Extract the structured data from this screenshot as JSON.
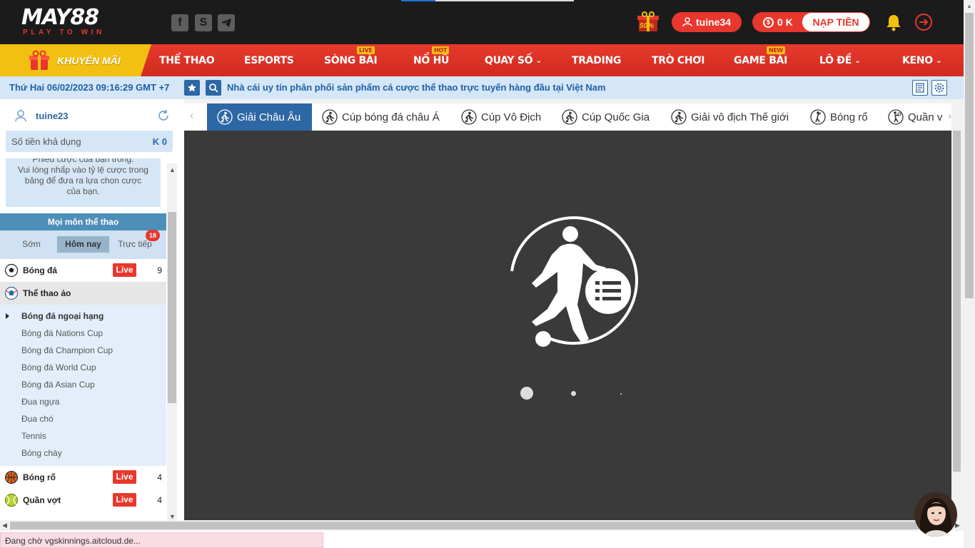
{
  "header": {
    "logo_text": "MAY88",
    "logo_tagline": "PLAY TO WIN",
    "promo_badge": "50%",
    "username": "tuine34",
    "balance": "0 K",
    "balance_currency": "$",
    "deposit_label": "NẠP TIỀN",
    "icons": [
      "facebook-icon",
      "skype-icon",
      "telegram-icon",
      "bell-icon",
      "logout-icon"
    ]
  },
  "nav": {
    "promo_label": "KHUYẾN MÃI",
    "items": [
      {
        "label": "THỂ THAO"
      },
      {
        "label": "ESPORTS"
      },
      {
        "label": "SÒNG BÀI",
        "badge": "LIVE"
      },
      {
        "label": "NỔ HŨ",
        "badge": "HOT"
      },
      {
        "label": "QUAY SỐ",
        "caret": "⌄"
      },
      {
        "label": "TRADING"
      },
      {
        "label": "TRÒ CHƠI"
      },
      {
        "label": "GAME BÀI",
        "badge": "NEW"
      },
      {
        "label": "LÔ ĐỀ",
        "caret": "⌄"
      },
      {
        "label": "KENO",
        "caret": "⌄"
      }
    ]
  },
  "infobar": {
    "datetime": "Thứ Hai 06/02/2023 09:16:29 GMT +7",
    "marquee": "Nhà cái uy tín phân phối sản phẩm cá cược thể thao trực tuyến hàng đầu tại Việt Nam"
  },
  "left": {
    "username": "tuine23",
    "available_label": "Số tiền khả dụng",
    "available_value": "K 0",
    "slip_lines": [
      "Phiếu cược của bạn trống.",
      "Vui lòng nhấp vào tỷ lệ cược trong",
      "bảng để đưa ra lựa chọn cược",
      "của bạn."
    ],
    "sports_header": "Mọi môn thể thao",
    "time_tabs": [
      "Sớm",
      "Hôm nay",
      "Trực tiếp"
    ],
    "live_count": "18",
    "sports": [
      {
        "name": "Bóng đá",
        "live": "Live",
        "count": "9"
      },
      {
        "name": "Thể thao ảo"
      },
      {
        "name": "Bóng rổ",
        "live": "Live",
        "count": "4"
      },
      {
        "name": "Quần vợt",
        "live": "Live",
        "count": "4"
      }
    ],
    "virtual_sub": [
      "Bóng đá ngoại hạng",
      "Bóng đá Nations Cup",
      "Bóng đá Champion Cup",
      "Bóng đá World Cup",
      "Bóng đá Asian Cup",
      "Đua ngựa",
      "Đua chó",
      "Tennis",
      "Bóng chày"
    ]
  },
  "league_tabs": [
    "Giải Châu Âu",
    "Cúp bóng đá châu Á",
    "Cúp Vô Địch",
    "Cúp Quốc Gia",
    "Giải vô địch Thế giới",
    "Bóng rổ",
    "Quần v"
  ],
  "status_bar": "Đang chờ vgskinnings.aitcloud.de...",
  "colors": {
    "brand_red": "#e8372c",
    "promo_yellow": "#f3c012",
    "header_bg": "#1b1b1b",
    "accent_blue": "#2d67a6",
    "panel_dark": "#3a3a3a"
  }
}
